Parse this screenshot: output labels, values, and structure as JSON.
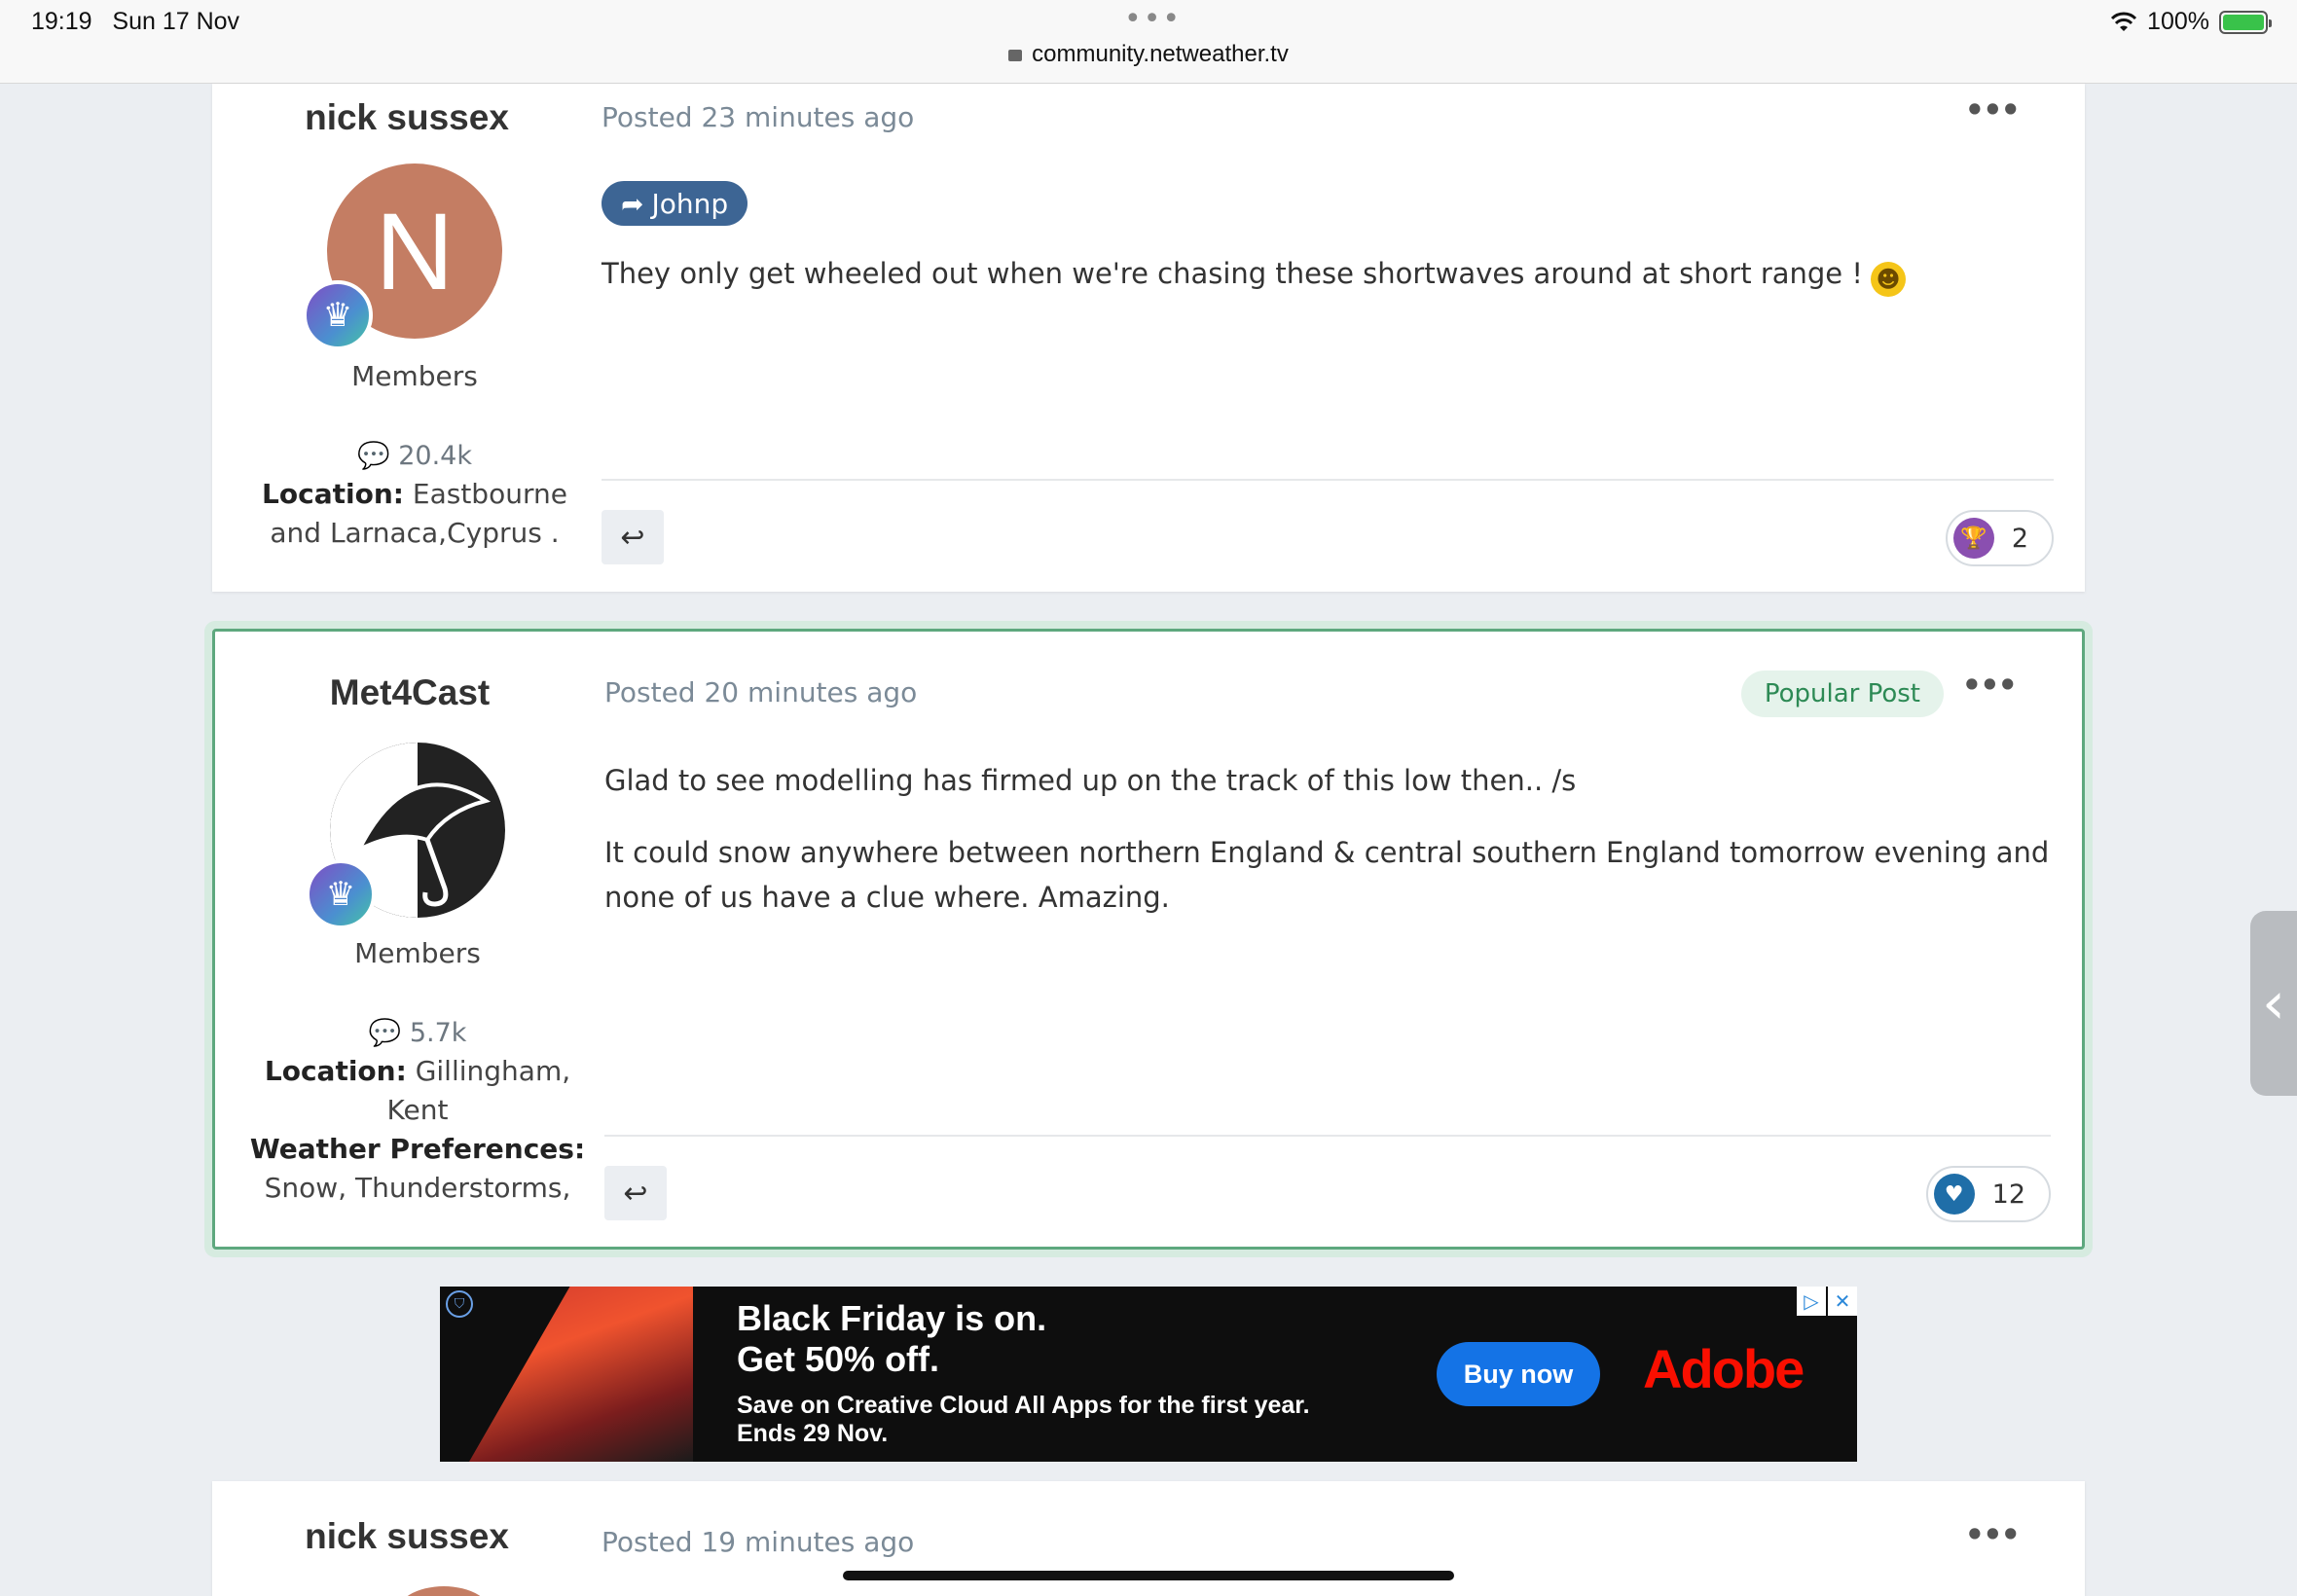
{
  "status_bar": {
    "time": "19:19",
    "date": "Sun 17 Nov",
    "url": "community.netweather.tv",
    "battery": "100%"
  },
  "posts": [
    {
      "author": "nick sussex",
      "avatar_letter": "N",
      "group": "Members",
      "post_count": "20.4k",
      "location_label": "Location:",
      "location": "Eastbourne and Larnaca,Cyprus .",
      "posted": "Posted 23 minutes ago",
      "quote_user": "Johnp",
      "content": "They only get wheeled out when we're chasing these shortwaves around at short range !",
      "reaction_count": "2"
    },
    {
      "author": "Met4Cast",
      "group": "Members",
      "post_count": "5.7k",
      "location_label": "Location:",
      "location": "Gillingham, Kent",
      "prefs_label": "Weather Preferences:",
      "prefs": "Snow, Thunderstorms,",
      "posted": "Posted 20 minutes ago",
      "badge": "Popular Post",
      "content_p1": "Glad to see modelling has firmed up on the track of this low then.. /s",
      "content_p2": "It could snow anywhere between northern England & central southern England tomorrow evening and none of us have a clue where. Amazing.",
      "reaction_count": "12"
    },
    {
      "author": "nick sussex",
      "posted": "Posted 19 minutes ago"
    }
  ],
  "ad": {
    "line1": "Black Friday is on.",
    "line2": "Get 50% off.",
    "line3": "Save on Creative Cloud All Apps for the first year.",
    "line4": "Ends 29 Nov.",
    "button": "Buy now",
    "brand": "Adobe"
  },
  "icons": [
    "wifi-icon",
    "battery-icon",
    "lock-icon",
    "more-icon",
    "reply-icon",
    "trophy-icon",
    "heart-icon",
    "comment-icon",
    "crown-icon",
    "share-arrow-icon"
  ],
  "colors": {
    "quote_tag": "#3d6594",
    "popular_border": "#5ea87e",
    "heart": "#1f6ea8",
    "trophy": "#8a4fb0"
  }
}
